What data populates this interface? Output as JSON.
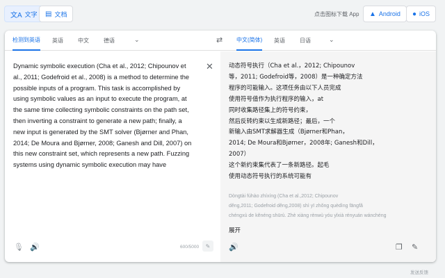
{
  "topbar": {
    "text_mode": {
      "label": "文字",
      "icon": "translate-icon"
    },
    "doc_mode": {
      "label": "文档",
      "icon": "document-icon"
    },
    "download_text": "点击图标下载 App",
    "android": {
      "label": "Android",
      "icon": "android-icon"
    },
    "ios": {
      "label": "iOS",
      "icon": "apple-icon"
    }
  },
  "source_langs": [
    "检测到英语",
    "英语",
    "中文",
    "德语"
  ],
  "target_langs": [
    "中文(简体)",
    "英语",
    "日语"
  ],
  "source": {
    "text": "Dynamic symbolic execution (Cha et al., 2012; Chipounov et al., 2011; Godefroid et al., 2008) is a method to determine the possible inputs of a program. This task is accomplished by using symbolic values as an input to execute the program, at the same time collecting symbolic constraints on the path set, then inverting a constraint to generate a new path; finally, a new input is generated by the SMT solver (Bjørner and Phan, 2014; De Moura and Bjørner, 2008; Ganesh and Dill, 2007) on this new constraint set, which represents a new path. Fuzzing systems using dynamic symbolic execution may have",
    "char_count": "600/5000"
  },
  "target": {
    "lines": [
      "动态符号执行（Cha et al.，2012; Chipounov",
      "等，2011; Godefroid等，2008）是一种确定方法",
      "程序的可能输入。这项任务由以下人员完成",
      "使用符号值作为执行程序的输入，at",
      "同时收集路径集上的符号约束，",
      "然后反转约束以生成新路径；最后，一个",
      "新输入由SMT求解器生成（Bjørner和Phan，",
      "2014; De Moura和Bjørner，2008年; Ganesh和Dill，2007）",
      "这个新约束集代表了一条新路径。起毛",
      "使用动态符号执行的系统可能有"
    ],
    "pinyin_lines": [
      "Dòngtài fúhào zhíxíng (Cha et al.,2012; Chipounov",
      "děng,2011; Godefroid děng,2008) shì yī zhǒng quèdìng fāngfǎ",
      "chéngxù de kěnéng shūrù. Zhè xiàng rènwù yóu yǐxià rényuán wánchéng"
    ],
    "expand_label": "展开"
  },
  "footer": {
    "feedback": "发送反馈"
  },
  "colors": {
    "accent": "#1a73e8",
    "target_bg": "#f5f5f5"
  }
}
